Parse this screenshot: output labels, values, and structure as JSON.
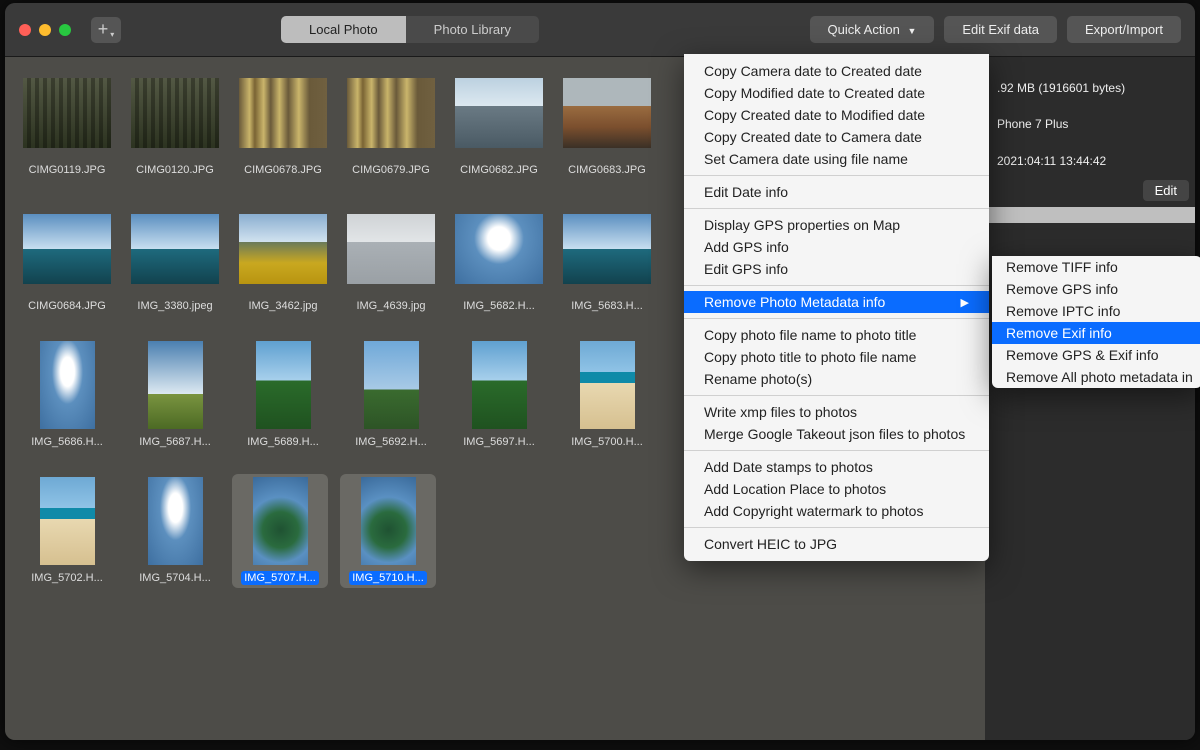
{
  "toolbar": {
    "tab_local": "Local Photo",
    "tab_library": "Photo Library",
    "quick_action": "Quick Action",
    "edit_exif": "Edit Exif data",
    "export_import": "Export/Import"
  },
  "thumbnails": [
    {
      "label": "CIMG0119.JPG",
      "cls": "fence1",
      "portrait": false
    },
    {
      "label": "CIMG0120.JPG",
      "cls": "fence1",
      "portrait": false
    },
    {
      "label": "CIMG0678.JPG",
      "cls": "pillar",
      "portrait": false
    },
    {
      "label": "CIMG0679.JPG",
      "cls": "pillar",
      "portrait": false
    },
    {
      "label": "CIMG0682.JPG",
      "cls": "overpass",
      "portrait": false
    },
    {
      "label": "CIMG0683.JPG",
      "cls": "roof",
      "portrait": false
    },
    {
      "label": "CIMG0684.JPG",
      "cls": "sky2",
      "portrait": false
    },
    {
      "label": "IMG_3380.jpeg",
      "cls": "sky2",
      "portrait": false
    },
    {
      "label": "IMG_3462.jpg",
      "cls": "mtn",
      "portrait": false
    },
    {
      "label": "IMG_4639.jpg",
      "cls": "bldg",
      "portrait": false
    },
    {
      "label": "IMG_5682.H...",
      "cls": "cloud",
      "portrait": false
    },
    {
      "label": "IMG_5683.H...",
      "cls": "sky2",
      "portrait": false
    },
    {
      "label": "IMG_5686.H...",
      "cls": "cloud",
      "portrait": true
    },
    {
      "label": "IMG_5687.H...",
      "cls": "sky3",
      "portrait": true
    },
    {
      "label": "IMG_5689.H...",
      "cls": "green",
      "portrait": true
    },
    {
      "label": "IMG_5692.H...",
      "cls": "sky1",
      "portrait": true
    },
    {
      "label": "IMG_5697.H...",
      "cls": "green",
      "portrait": true
    },
    {
      "label": "IMG_5700.H...",
      "cls": "beach",
      "portrait": true
    },
    {
      "label": "IMG_5702.H...",
      "cls": "beach",
      "portrait": true
    },
    {
      "label": "IMG_5704.H...",
      "cls": "cloud",
      "portrait": true
    },
    {
      "label": "IMG_5707.H...",
      "cls": "leaf",
      "portrait": true,
      "selected": true
    },
    {
      "label": "IMG_5710.H...",
      "cls": "leaf",
      "portrait": true,
      "selected": true
    }
  ],
  "side": {
    "size": ".92 MB (1916601 bytes)",
    "device": "Phone 7 Plus",
    "date": "2021:04:11 13:44:42",
    "edit": "Edit"
  },
  "menu": {
    "items": [
      {
        "label": "Copy Camera date to Created date"
      },
      {
        "label": "Copy Modified date to Created date"
      },
      {
        "label": "Copy Created date to Modified date"
      },
      {
        "label": "Copy Created date to Camera date"
      },
      {
        "label": "Set Camera date using file name"
      },
      {
        "sep": true
      },
      {
        "label": "Edit Date info"
      },
      {
        "sep": true
      },
      {
        "label": "Display GPS properties on Map"
      },
      {
        "label": "Add GPS info"
      },
      {
        "label": "Edit GPS  info"
      },
      {
        "sep": true
      },
      {
        "label": "Remove Photo Metadata info",
        "hi": true,
        "submenu": true
      },
      {
        "sep": true
      },
      {
        "label": "Copy photo file name to photo title"
      },
      {
        "label": "Copy photo title to photo file name"
      },
      {
        "label": "Rename photo(s)"
      },
      {
        "sep": true
      },
      {
        "label": "Write xmp files to photos"
      },
      {
        "label": "Merge Google Takeout json files to photos"
      },
      {
        "sep": true
      },
      {
        "label": "Add Date stamps to photos"
      },
      {
        "label": "Add Location Place to photos"
      },
      {
        "label": "Add Copyright watermark to photos"
      },
      {
        "sep": true
      },
      {
        "label": "Convert HEIC to JPG"
      }
    ],
    "submenu": [
      {
        "label": "Remove TIFF info"
      },
      {
        "label": "Remove GPS info"
      },
      {
        "label": "Remove IPTC info"
      },
      {
        "label": "Remove Exif info",
        "hi": true
      },
      {
        "label": "Remove GPS & Exif info"
      },
      {
        "label": "Remove All photo metadata in"
      }
    ]
  }
}
